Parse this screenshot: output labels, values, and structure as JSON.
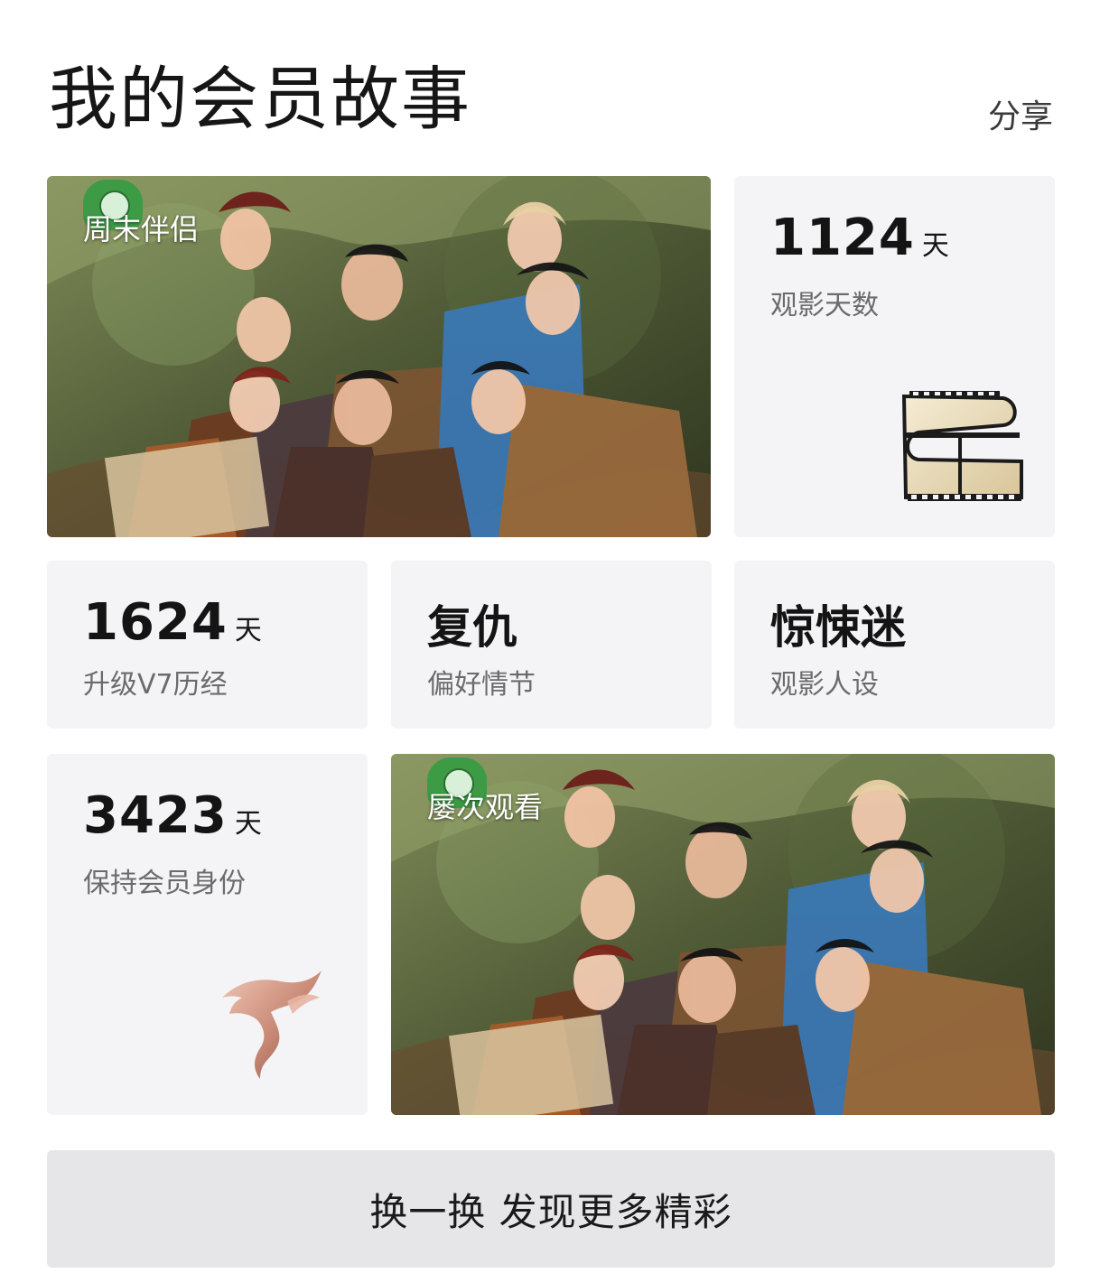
{
  "header": {
    "title": "我的会员故事",
    "share_label": "分享"
  },
  "cards": {
    "weekend_partner": {
      "label": "周末伴侣"
    },
    "watch_days": {
      "value": "1124",
      "unit": "天",
      "label": "观影天数"
    },
    "upgrade": {
      "value": "1624",
      "unit": "天",
      "label": "升级V7历经"
    },
    "plot": {
      "value": "复仇",
      "label": "偏好情节"
    },
    "persona": {
      "value": "惊悚迷",
      "label": "观影人设"
    },
    "membership": {
      "value": "3423",
      "unit": "天",
      "label": "保持会员身份"
    },
    "repeat_watch": {
      "label": "屡次观看"
    }
  },
  "refresh_button": {
    "label": "换一换 发现更多精彩"
  },
  "colors": {
    "card_bg": "#f4f4f6",
    "button_bg": "#e6e6e8",
    "badge_green": "#3d9a45",
    "film_beige": "#eadfbf",
    "ribbon_rose": "#c98873"
  },
  "icons": {
    "film": "film-reel-icon",
    "seven": "v7-ribbon-icon",
    "badge": "show-logo-icon"
  }
}
